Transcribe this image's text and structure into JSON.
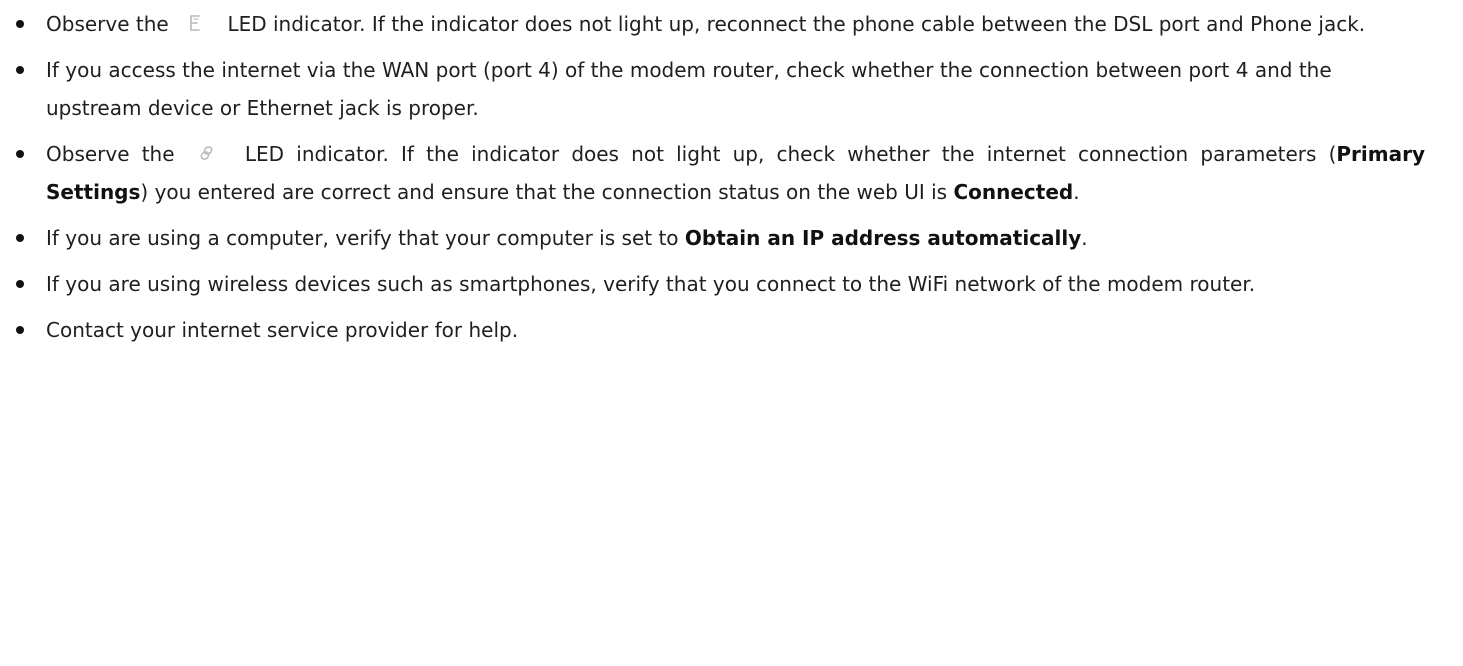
{
  "bullets": [
    {
      "before_icon": "Observe the",
      "icon": "dsl-led-icon",
      "after_icon": "LED indicator. If the indicator does not light up, reconnect the phone cable between the DSL port and Phone jack."
    },
    {
      "text": "If you access the internet via the WAN port (port 4) of the modem router, check whether the connection between port 4 and the upstream device or Ethernet jack is proper."
    },
    {
      "before_icon": "Observe the",
      "icon": "internet-led-icon",
      "after_icon_part1": "LED indicator. If the indicator does not light up, check whether the internet connection parameters (",
      "bold1": "Primary Settings",
      "after_icon_part2": ") you entered are correct and ensure that the connection status on the web UI is ",
      "bold2": "Connected",
      "after_icon_part3": "."
    },
    {
      "text_before": "If you are using a computer, verify that your computer is set to ",
      "bold": "Obtain an IP address automatically",
      "text_after": "."
    },
    {
      "text": "If you are using wireless devices such as smartphones, verify that you connect to the WiFi network of the modem router."
    },
    {
      "text": "Contact your internet service provider for help."
    }
  ]
}
